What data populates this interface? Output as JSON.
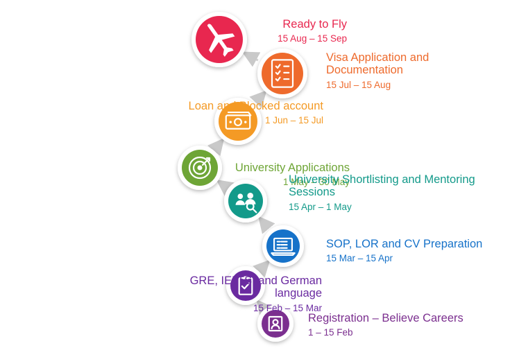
{
  "steps": [
    {
      "title": "Ready to Fly",
      "date": "15 Aug – 15 Sep",
      "color": "#e8274f",
      "icon": "airplane-icon"
    },
    {
      "title": "Visa Application and Documentation",
      "date": "15 Jul – 15 Aug",
      "color": "#ee6a2c",
      "icon": "checklist-icon"
    },
    {
      "title": "Loan and Blocked account",
      "date": "1 Jun – 15 Jul",
      "color": "#f49a25",
      "icon": "money-icon"
    },
    {
      "title": "University Applications",
      "date": "1 May – 30 May",
      "color": "#6ea536",
      "icon": "target-icon"
    },
    {
      "title": "University Shortlisting and Mentoring Sessions",
      "date": "15 Apr – 1 May",
      "color": "#139a8a",
      "icon": "mentoring-icon"
    },
    {
      "title": "SOP, LOR and CV Preparation",
      "date": "15 Mar – 15 Apr",
      "color": "#1672c9",
      "icon": "laptop-icon"
    },
    {
      "title": "GRE, IELTS, and German language",
      "date": "15 Feb – 15 Mar",
      "color": "#6a2aa0",
      "icon": "clipboard-icon"
    },
    {
      "title": "Registration – Believe Careers",
      "date": "1 – 15 Feb",
      "color": "#7b2f8f",
      "icon": "profile-icon"
    }
  ]
}
